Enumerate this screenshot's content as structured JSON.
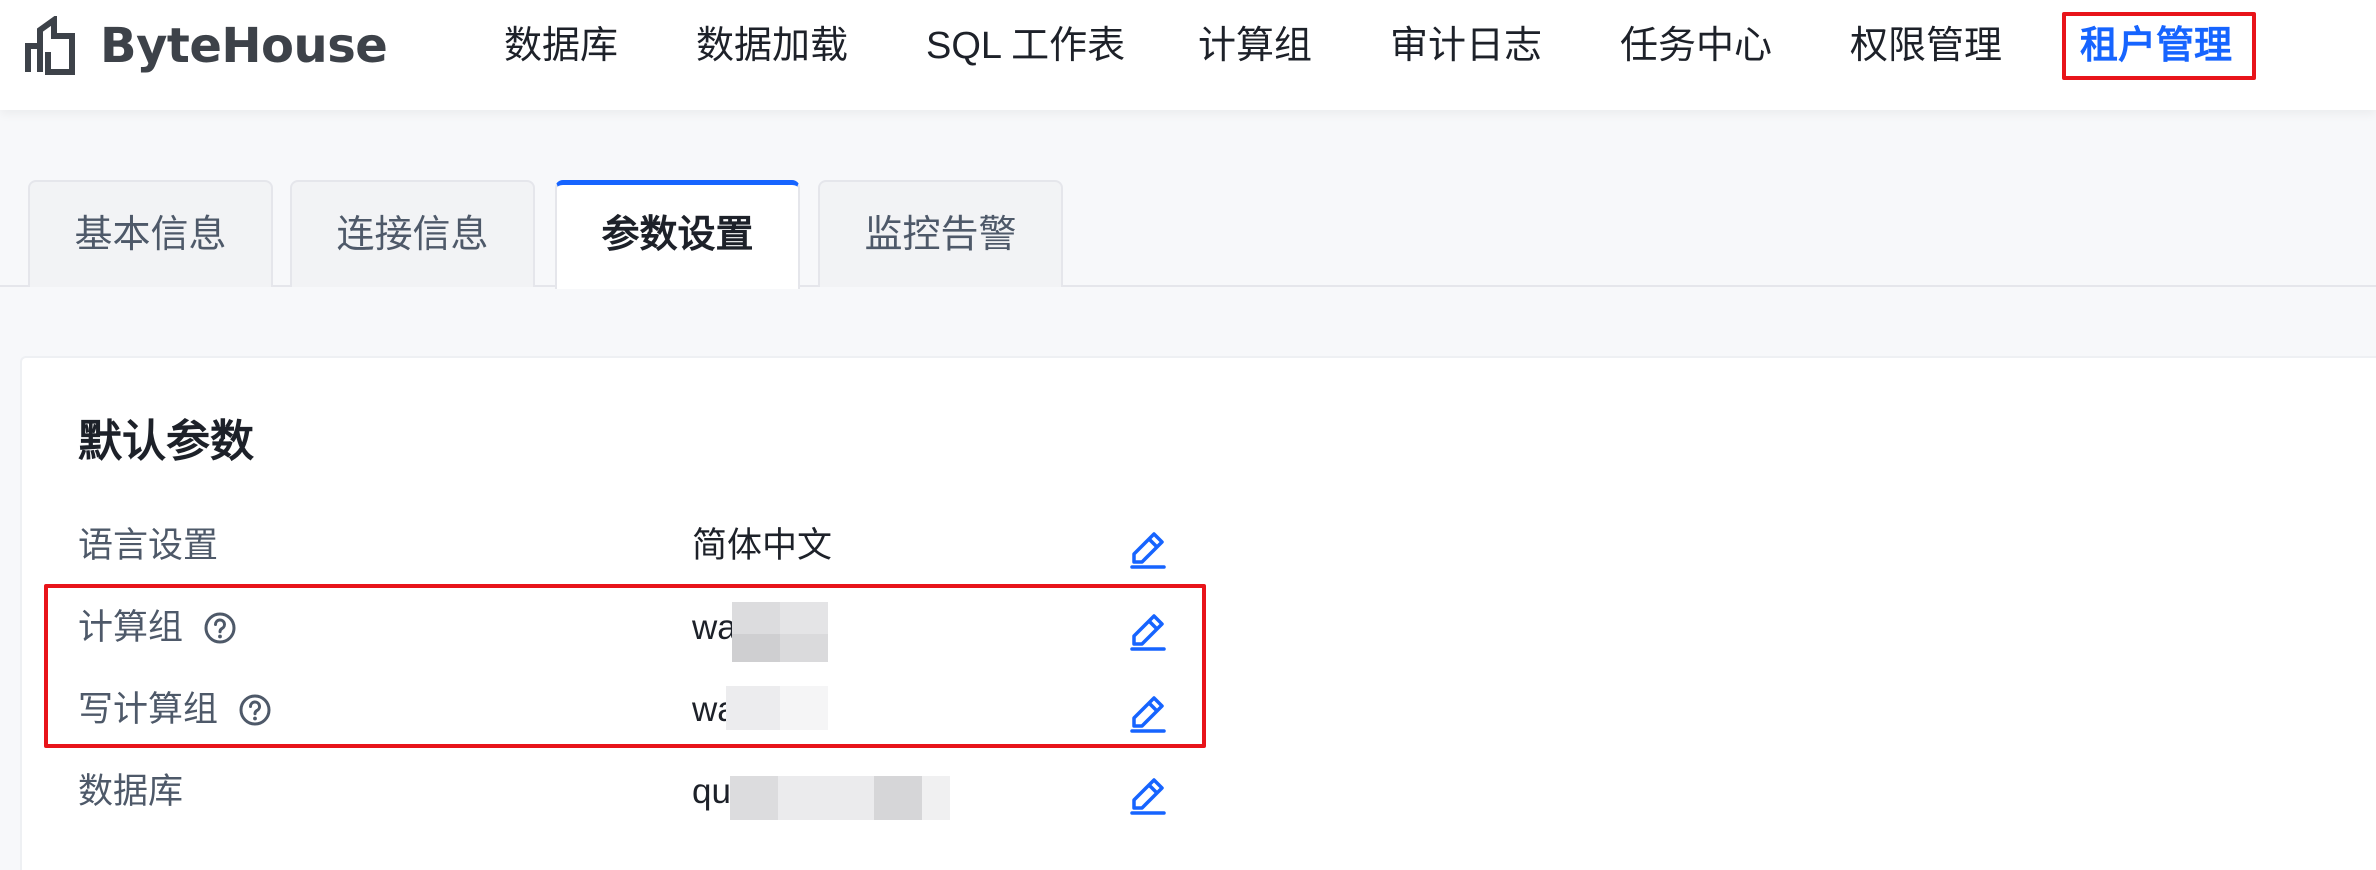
{
  "app": {
    "logo_text": "ByteHouse",
    "logo_icon": "bytehouse-logo-icon"
  },
  "nav": {
    "items": [
      {
        "label": "数据库"
      },
      {
        "label": "数据加载"
      },
      {
        "label": "SQL 工作表"
      },
      {
        "label": "计算组"
      },
      {
        "label": "审计日志"
      },
      {
        "label": "任务中心"
      },
      {
        "label": "权限管理"
      },
      {
        "label": "租户管理",
        "active": true
      }
    ]
  },
  "tabs": [
    {
      "label": "基本信息"
    },
    {
      "label": "连接信息"
    },
    {
      "label": "参数设置",
      "active": true
    },
    {
      "label": "监控告警"
    }
  ],
  "section": {
    "title": "默认参数",
    "params": [
      {
        "label": "语言设置",
        "value": "简体中文",
        "has_help": false
      },
      {
        "label": "计算组",
        "value": "wa",
        "has_help": true,
        "value_obscured": true
      },
      {
        "label": "写计算组",
        "value": "wa",
        "has_help": true,
        "value_obscured": true
      },
      {
        "label": "数据库",
        "value": "qu",
        "has_help": false,
        "value_obscured": true
      }
    ]
  },
  "colors": {
    "accent": "#1664ff",
    "highlight_box": "#e8141a",
    "text_primary": "#1d2129",
    "text_secondary": "#4e5969"
  }
}
